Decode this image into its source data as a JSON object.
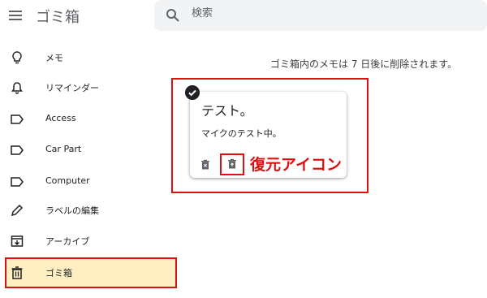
{
  "header": {
    "menu_icon": "hamburger-menu-icon",
    "title": "ゴミ箱",
    "search": {
      "icon": "search-icon",
      "placeholder": "検索"
    }
  },
  "sidebar": {
    "items": [
      {
        "label": "メモ",
        "icon": "lightbulb-icon"
      },
      {
        "label": "リマインダー",
        "icon": "bell-icon"
      },
      {
        "label": "Access",
        "icon": "label-icon"
      },
      {
        "label": "Car Part",
        "icon": "label-icon"
      },
      {
        "label": "Computer",
        "icon": "label-icon"
      },
      {
        "label": "ラベルの編集",
        "icon": "pencil-icon"
      },
      {
        "label": "アーカイブ",
        "icon": "archive-icon"
      },
      {
        "label": "ゴミ箱",
        "icon": "trash-icon",
        "active": true
      }
    ]
  },
  "main": {
    "info": "ゴミ箱内のメモは 7 日後に削除されます。",
    "note": {
      "title": "テスト。",
      "body": "マイクのテスト中。",
      "actions": [
        "delete-forever-icon",
        "restore-icon"
      ]
    },
    "annotation": {
      "label": "復元アイコン",
      "color": "#e01010"
    }
  },
  "colors": {
    "active_bg": "#feefc3",
    "highlight": "#e01010"
  }
}
